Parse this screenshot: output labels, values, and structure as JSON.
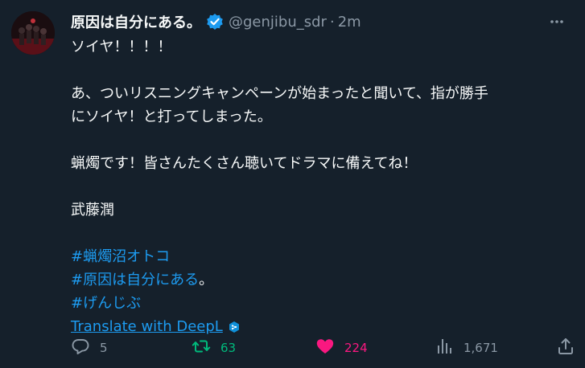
{
  "author": {
    "display_name": "原因は自分にある。",
    "handle": "@genjibu_sdr",
    "separator": "·",
    "time": "2m"
  },
  "tweet": {
    "lines": [
      "ソイヤ！！！！",
      "",
      "あ、ついリスニングキャンペーンが始まったと聞いて、指が勝手",
      "にソイヤ！と打ってしまった。",
      "",
      "蝋燭です！皆さんたくさん聴いてドラマに備えてね！",
      "",
      "武藤潤",
      ""
    ],
    "hashtags": [
      {
        "tag": "#蝋燭沼オトコ",
        "suffix": ""
      },
      {
        "tag": "#原因は自分にある",
        "suffix": "。"
      },
      {
        "tag": "#げんじぶ",
        "suffix": ""
      }
    ],
    "translate_label": "Translate with DeepL"
  },
  "actions": {
    "reply_count": "5",
    "retweet_count": "63",
    "like_count": "224",
    "views_count": "1,671"
  },
  "colors": {
    "background": "#15202b",
    "link": "#1d9bf0",
    "retweet": "#00ba7c",
    "like": "#f91880",
    "muted": "#8b98a5"
  }
}
